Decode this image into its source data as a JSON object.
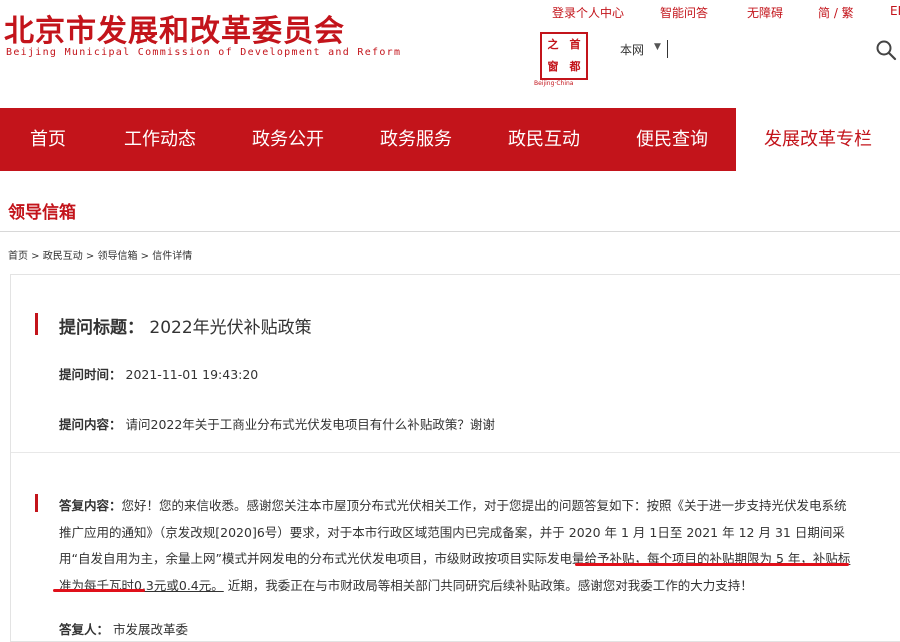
{
  "header": {
    "title_cn": "北京市发展和改革委员会",
    "title_en": "Beijing Municipal Commission of Development and Reform",
    "top_links": [
      "登录个人中心",
      "智能问答",
      "无障碍",
      "简 / 繁",
      "EN"
    ],
    "seal_chars": [
      "之",
      "首",
      "窗",
      "都"
    ],
    "seal_caption": "Beijing·China",
    "search": {
      "scope": "本网",
      "placeholder": ""
    }
  },
  "nav": {
    "items": [
      "首页",
      "工作动态",
      "政务公开",
      "政务服务",
      "政民互动",
      "便民查询",
      "发展改革专栏"
    ],
    "active": "发展改革专栏"
  },
  "section_title": "领导信箱",
  "breadcrumb": "首页 > 政民互动 > 领导信箱 > 信件详情",
  "letter": {
    "title_label": "提问标题：",
    "title_value": "2022年光伏补贴政策",
    "time_label": "提问时间：",
    "time_value": "2021-11-01 19:43:20",
    "content_label": "提问内容：",
    "content_value": "请问2022年关于工商业分布式光伏发电项目有什么补贴政策？谢谢",
    "answer_label": "答复内容：",
    "answer_part1": "您好！您的来信收悉。感谢您关注本市屋顶分布式光伏相关工作，对于您提出的问题答复如下：按照《关于进一步支持光伏发电系统推广应用的通知》（京发改规[2020]6号）要求，对于本市行政区域范围内已完成备案，并于 2020 年 1 月 1日至 2021 年 12 月 31 日期间采用“自发自用为主，余量上网”模式并网发电的分布式光伏发电项目，市级财政按项目实际发电量给予补贴，",
    "answer_highlight": "每个项目的补贴期限为 5 年，补贴标准为每千瓦时0.3元或0.4元。",
    "answer_part2": "近期，我委正在与市财政局等相关部门共同研究后续补贴政策。感谢您对我委工作的大力支持！",
    "replier_label": "答复人：",
    "replier_value": "市发展改革委"
  },
  "colors": {
    "brand_red": "#c3141b",
    "annotation_red": "#e0101a"
  },
  "icons": [
    "search-icon",
    "seal-logo"
  ]
}
